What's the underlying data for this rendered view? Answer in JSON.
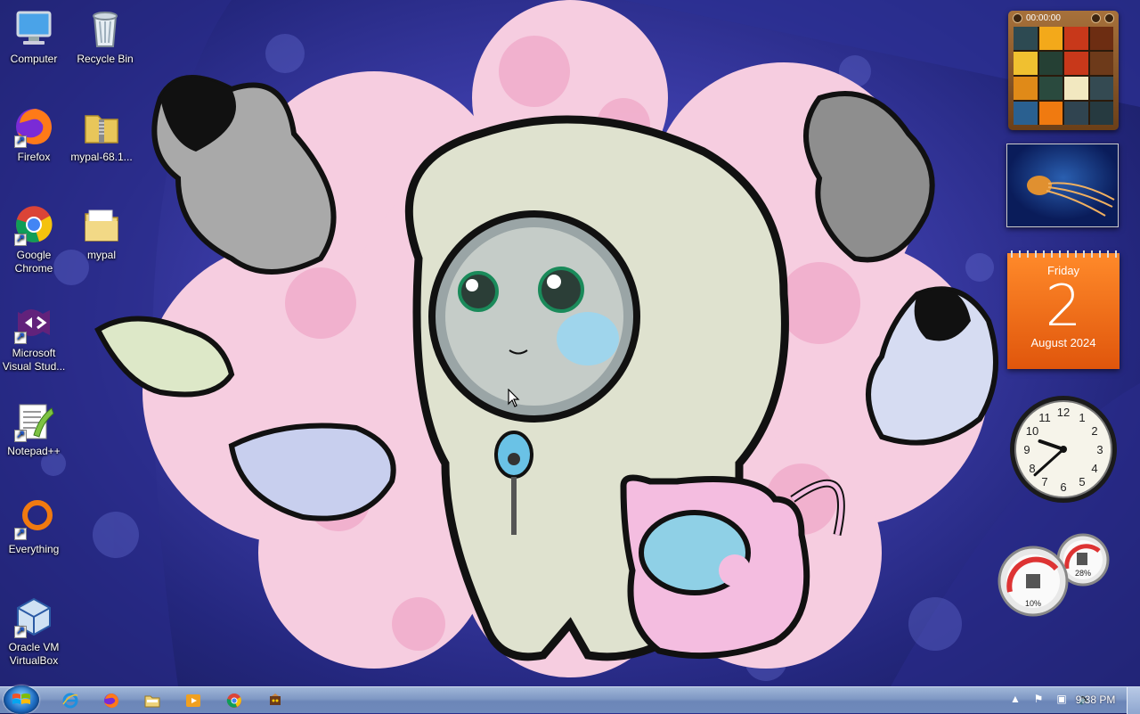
{
  "desktop": {
    "icons": [
      {
        "label": "Computer",
        "icon": "computer-icon"
      },
      {
        "label": "Recycle Bin",
        "icon": "recycle-bin-icon"
      },
      {
        "label": "Firefox",
        "icon": "firefox-icon"
      },
      {
        "label": "mypal-68.1...",
        "icon": "zip-folder-icon"
      },
      {
        "label": "Google Chrome",
        "icon": "chrome-icon"
      },
      {
        "label": "mypal",
        "icon": "folder-icon"
      },
      {
        "label": "Microsoft Visual Stud...",
        "icon": "visual-studio-icon"
      },
      {
        "label": "Notepad++",
        "icon": "notepad-plus-plus-icon"
      },
      {
        "label": "Everything",
        "icon": "everything-search-icon"
      },
      {
        "label": "Oracle VM VirtualBox",
        "icon": "virtualbox-icon"
      }
    ]
  },
  "gadgets": {
    "puzzle": {
      "timer": "00:00:00"
    },
    "calendar": {
      "weekday": "Friday",
      "day": "2",
      "month_year": "August 2024"
    },
    "clock": {
      "hour": 9,
      "minute": 38
    },
    "meters": {
      "cpu": "10%",
      "memory": "28%"
    }
  },
  "taskbar": {
    "pinned": [
      "internet-explorer-icon",
      "firefox-icon",
      "file-explorer-icon",
      "media-player-icon",
      "chrome-icon",
      "game-icon"
    ],
    "time": "9:38 PM"
  },
  "colors": {
    "wallpaper_blue": "#3f3fae",
    "calendar_orange": "#f07020",
    "taskbar": "#7f98c4"
  }
}
